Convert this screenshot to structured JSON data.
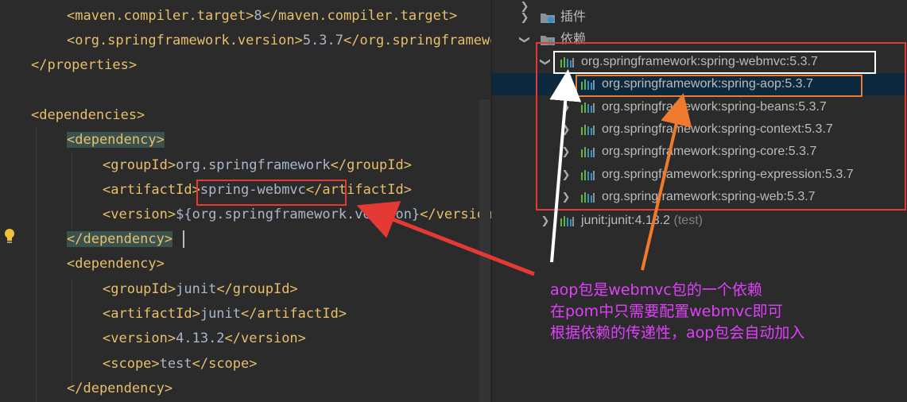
{
  "editor": {
    "lines": [
      {
        "id": "l1",
        "segments": [
          {
            "t": "tag",
            "v": "<maven.compiler.target>"
          },
          {
            "t": "txt",
            "v": "8"
          },
          {
            "t": "tag",
            "v": "</maven.compiler.target>"
          }
        ]
      },
      {
        "id": "l2",
        "segments": [
          {
            "t": "tag",
            "v": "<org.springframework.version>"
          },
          {
            "t": "txt",
            "v": "5.3.7"
          },
          {
            "t": "tag",
            "v": "</org.springframework.version>"
          }
        ]
      },
      {
        "id": "l3",
        "segments": [
          {
            "t": "tag",
            "v": "</properties>"
          }
        ]
      },
      {
        "id": "l5",
        "segments": [
          {
            "t": "tag",
            "v": "<dependencies>"
          }
        ]
      },
      {
        "id": "l6",
        "segments": [
          {
            "t": "tag hl",
            "v": "<dependency>"
          }
        ]
      },
      {
        "id": "l7",
        "segments": [
          {
            "t": "tag",
            "v": "<groupId>"
          },
          {
            "t": "txt",
            "v": "org.springframework"
          },
          {
            "t": "tag",
            "v": "</groupId>"
          }
        ]
      },
      {
        "id": "l8",
        "segments": [
          {
            "t": "tag",
            "v": "<artifactId"
          },
          {
            "t": "tag",
            "v": ">"
          },
          {
            "t": "txt",
            "v": "spring-webmvc"
          },
          {
            "t": "tag",
            "v": "</"
          },
          {
            "t": "tag",
            "v": "artifactId>"
          }
        ]
      },
      {
        "id": "l9",
        "segments": [
          {
            "t": "tag",
            "v": "<version>"
          },
          {
            "t": "txt",
            "v": "${org.springframework.version}"
          },
          {
            "t": "tag",
            "v": "</version>"
          }
        ]
      },
      {
        "id": "l10",
        "segments": [
          {
            "t": "tag hl",
            "v": "</dependency>"
          }
        ]
      },
      {
        "id": "l11",
        "segments": [
          {
            "t": "tag",
            "v": "<dependency>"
          }
        ]
      },
      {
        "id": "l12",
        "segments": [
          {
            "t": "tag",
            "v": "<groupId>"
          },
          {
            "t": "txt",
            "v": "junit"
          },
          {
            "t": "tag",
            "v": "</groupId>"
          }
        ]
      },
      {
        "id": "l13",
        "segments": [
          {
            "t": "tag",
            "v": "<artifactId>"
          },
          {
            "t": "txt",
            "v": "junit"
          },
          {
            "t": "tag",
            "v": "</artifactId>"
          }
        ]
      },
      {
        "id": "l14",
        "segments": [
          {
            "t": "tag",
            "v": "<version>"
          },
          {
            "t": "txt",
            "v": "4.13.2"
          },
          {
            "t": "tag",
            "v": "</version>"
          }
        ]
      },
      {
        "id": "l15",
        "segments": [
          {
            "t": "tag",
            "v": "<scope>"
          },
          {
            "t": "txt",
            "v": "test"
          },
          {
            "t": "tag",
            "v": "</scope>"
          }
        ]
      },
      {
        "id": "l16",
        "segments": [
          {
            "t": "tag",
            "v": "</dependency>"
          }
        ]
      }
    ]
  },
  "maven": {
    "plugins_label": "插件",
    "dependencies_label": "依赖",
    "webmvc": "org.springframework:spring-webmvc:5.3.7",
    "children": [
      "org.springframework:spring-aop:5.3.7",
      "org.springframework:spring-beans:5.3.7",
      "org.springframework:spring-context:5.3.7",
      "org.springframework:spring-core:5.3.7",
      "org.springframework:spring-expression:5.3.7",
      "org.springframework:spring-web:5.3.7"
    ],
    "junit": "junit:junit:4.13.2",
    "junit_scope": "(test)"
  },
  "annotation": {
    "line1": "aop包是webmvc包的一个依赖",
    "line2": "在pom中只需要配置webmvc即可",
    "line3": "根据依赖的传递性，aop包会自动加入"
  },
  "colors": {
    "tag": "#e8bf6a",
    "text": "#a9b7c6",
    "red_box": "#e53935",
    "white_box": "#ffffff",
    "orange_box": "#ef7a2d",
    "annotation": "#e040fb"
  }
}
